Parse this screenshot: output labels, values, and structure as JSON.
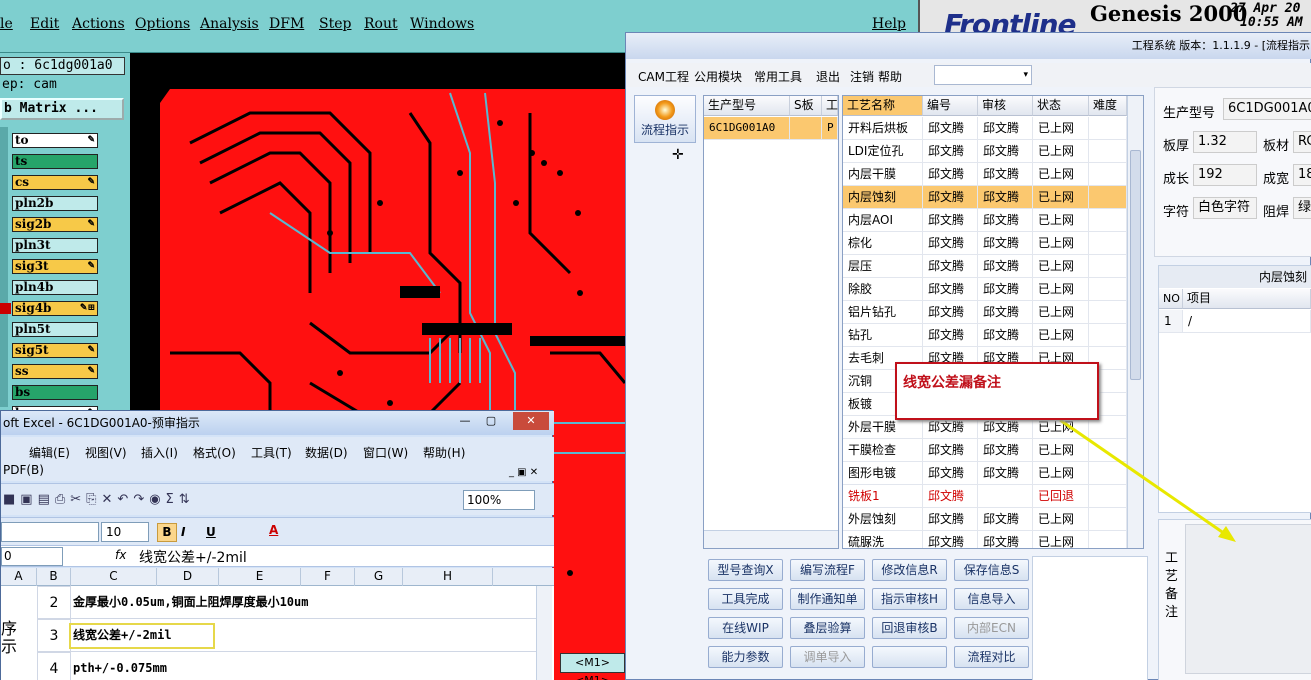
{
  "genesis": {
    "menu": [
      "le",
      "Edit",
      "Actions",
      "Options",
      "Analysis",
      "DFM",
      "Step",
      "Rout",
      "Windows",
      "Help"
    ],
    "brand": "Frontline",
    "product": "Genesis 2000",
    "date": "27 Apr 20",
    "time": "10:55 AM",
    "job_line": "o : 6c1dg001a0",
    "step_line": "ep: cam",
    "matrix_btn": "b Matrix ...",
    "layers": [
      {
        "name": "to",
        "color": "#ffffff",
        "icon": "✎"
      },
      {
        "name": "ts",
        "color": "#26a46a",
        "icon": ""
      },
      {
        "name": "cs",
        "color": "#f7c948",
        "icon": "✎"
      },
      {
        "name": "pln2b",
        "color": "#bfeaea",
        "icon": ""
      },
      {
        "name": "sig2b",
        "color": "#f7c948",
        "icon": "✎"
      },
      {
        "name": "pln3t",
        "color": "#bfeaea",
        "icon": ""
      },
      {
        "name": "sig3t",
        "color": "#f7c948",
        "icon": "✎"
      },
      {
        "name": "pln4b",
        "color": "#bfeaea",
        "icon": ""
      },
      {
        "name": "sig4b",
        "color": "#f7c948",
        "icon": "✎⊞"
      },
      {
        "name": "pln5t",
        "color": "#bfeaea",
        "icon": ""
      },
      {
        "name": "sig5t",
        "color": "#f7c948",
        "icon": "✎"
      },
      {
        "name": "ss",
        "color": "#f7c948",
        "icon": "✎"
      },
      {
        "name": "bs",
        "color": "#26a46a",
        "icon": ""
      },
      {
        "name": "bo",
        "color": "#ffffff",
        "icon": "✎"
      }
    ],
    "status_tab": "<M1><M1>"
  },
  "excel": {
    "title": "oft Excel - 6C1DG001A0-预审指示",
    "menu": [
      "编辑(E)",
      "视图(V)",
      "插入(I)",
      "格式(O)",
      "工具(T)",
      "数据(D)",
      "窗口(W)",
      "帮助(H)"
    ],
    "pdf": "PDF(B)",
    "font_size": "10",
    "zoom": "100%",
    "name_box": "0",
    "formula": "线宽公差+/-2mil",
    "columns": [
      "A",
      "B",
      "C",
      "D",
      "E",
      "F",
      "G",
      "H"
    ],
    "rows": [
      {
        "num": "2",
        "text": "金厚最小0.05um,铜面上阻焊厚度最小10um"
      },
      {
        "num": "3",
        "text": "线宽公差+/-2mil"
      },
      {
        "num": "4",
        "text": "pth+/-0.075mm"
      }
    ],
    "side_text": "序\n示"
  },
  "cam": {
    "title": "工程系统  版本：1.1.1.9 - [流程指示",
    "menu": [
      "CAM工程",
      "公用模块",
      "常用工具",
      "退出",
      "注销",
      "帮助"
    ],
    "nav_btn": "流程指示",
    "left_grid": {
      "headers": [
        "生产型号",
        "S板",
        "工"
      ],
      "row": [
        "6C1DG001A0",
        "",
        "P"
      ]
    },
    "proc_grid": {
      "headers": [
        "工艺名称",
        "编号",
        "审核",
        "状态",
        "难度"
      ],
      "rows": [
        [
          "开料后烘板",
          "邱文腾",
          "邱文腾",
          "已上网",
          "",
          ""
        ],
        [
          "LDI定位孔",
          "邱文腾",
          "邱文腾",
          "已上网",
          "",
          ""
        ],
        [
          "内层干膜",
          "邱文腾",
          "邱文腾",
          "已上网",
          "",
          ""
        ],
        [
          "内层蚀刻",
          "邱文腾",
          "邱文腾",
          "已上网",
          "",
          "sel"
        ],
        [
          "内层AOI",
          "邱文腾",
          "邱文腾",
          "已上网",
          "",
          ""
        ],
        [
          "棕化",
          "邱文腾",
          "邱文腾",
          "已上网",
          "",
          ""
        ],
        [
          "层压",
          "邱文腾",
          "邱文腾",
          "已上网",
          "",
          ""
        ],
        [
          "除胶",
          "邱文腾",
          "邱文腾",
          "已上网",
          "",
          ""
        ],
        [
          "铝片钻孔",
          "邱文腾",
          "邱文腾",
          "已上网",
          "",
          ""
        ],
        [
          "钻孔",
          "邱文腾",
          "邱文腾",
          "已上网",
          "",
          ""
        ],
        [
          "去毛刺",
          "邱文腾",
          "邱文腾",
          "已上网",
          "",
          ""
        ],
        [
          "沉铜",
          "邱文腾",
          "邱文腾",
          "已上网",
          "",
          ""
        ],
        [
          "板镀",
          "邱文腾",
          "邱文腾",
          "已上网",
          "",
          ""
        ],
        [
          "外层干膜",
          "邱文腾",
          "邱文腾",
          "已上网",
          "",
          ""
        ],
        [
          "干膜检查",
          "邱文腾",
          "邱文腾",
          "已上网",
          "",
          ""
        ],
        [
          "图形电镀",
          "邱文腾",
          "邱文腾",
          "已上网",
          "",
          ""
        ],
        [
          "铣板1",
          "邱文腾",
          "",
          "已回退",
          "",
          "red"
        ],
        [
          "外层蚀刻",
          "邱文腾",
          "邱文腾",
          "已上网",
          "",
          ""
        ],
        [
          "硫脲洗",
          "邱文腾",
          "邱文腾",
          "已上网",
          "",
          ""
        ]
      ]
    },
    "buttons": [
      [
        "型号查询X",
        "编写流程F",
        "修改信息R",
        "保存信息S"
      ],
      [
        "工具完成",
        "制作通知单",
        "指示审核H",
        "信息导入"
      ],
      [
        "在线WIP",
        "叠层验算",
        "回退审核B",
        "内部ECN"
      ],
      [
        "能力参数",
        "调单导入",
        "",
        "流程对比"
      ]
    ],
    "disabled_buttons": [
      "内部ECN",
      "调单导入"
    ],
    "info": {
      "model_label": "生产型号",
      "model": "6C1DG001A0",
      "thick_label": "板厚",
      "thick": "1.32",
      "mat_label": "板材",
      "mat": "RC",
      "len_label": "成长",
      "len": "192",
      "wid_label": "成宽",
      "wid": "18",
      "char_label": "字符",
      "char": "白色字符",
      "mask_label": "阻焊",
      "mask": "绿"
    },
    "sub_title": "内层蚀刻",
    "sub_headers": [
      "NO",
      "项目"
    ],
    "sub_row": [
      "1",
      "/"
    ],
    "remark_label": "工\n艺\n备\n注"
  },
  "annotation": "线宽公差漏备注",
  "colors": {
    "pcb_red": "#ff1010",
    "teal": "#7ecfcf",
    "highlight": "#fbc86f",
    "annot": "#c0101a",
    "arrow": "#e8e800"
  }
}
